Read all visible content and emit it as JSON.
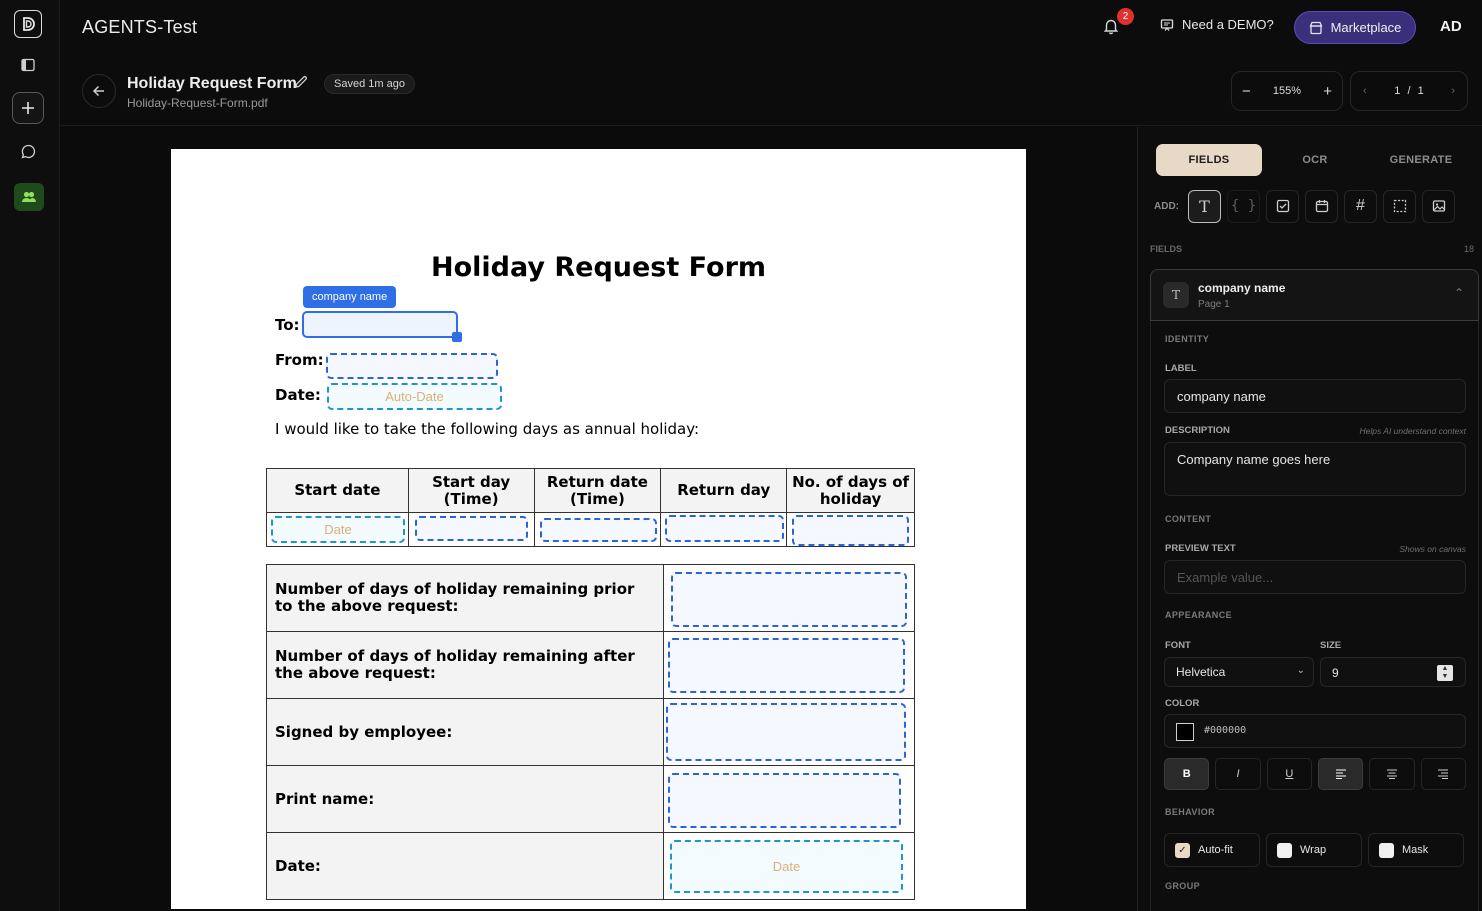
{
  "app": {
    "title": "AGENTS-Test",
    "notifications_count": "2",
    "demo_label": "Need a DEMO?",
    "marketplace_label": "Marketplace",
    "avatar_initials": "AD"
  },
  "doc": {
    "title": "Holiday Request Form",
    "saved_status": "Saved 1m ago",
    "filename": "Holiday-Request-Form.pdf",
    "zoom": "155%",
    "page_current": "1",
    "page_sep": "/",
    "page_total": "1"
  },
  "form": {
    "title": "Holiday Request Form",
    "selected_chip": "company name",
    "to_label": "To:",
    "from_label": "From:",
    "date_label": "Date:",
    "date_placeholder": "Auto-Date",
    "intro": "I would like to take the following days as annual holiday:",
    "table1_headers": [
      "Start date",
      "Start day (Time)",
      "Return date (Time)",
      "Return day",
      "No. of days of holiday"
    ],
    "table1_first_placeholder": "Date",
    "table2_rows": [
      "Number of days of holiday remaining prior to the above request:",
      "Number of days of holiday remaining after the above request:",
      "Signed by employee:",
      "Print name:",
      "Date:"
    ],
    "table2_date_placeholder": "Date"
  },
  "panel": {
    "tabs": [
      "FIELDS",
      "OCR",
      "GENERATE"
    ],
    "add_label": "ADD:",
    "tools": [
      "text-tool-icon",
      "variable-tool-icon",
      "checkbox-tool-icon",
      "calendar-tool-icon",
      "number-tool-icon",
      "region-tool-icon",
      "image-tool-icon"
    ],
    "fields_header": "FIELDS",
    "fields_count": "18",
    "field_card": {
      "name": "company name",
      "page": "Page 1"
    },
    "identity_section": "IDENTITY",
    "label_label": "LABEL",
    "label_value": "company name",
    "description_label": "DESCRIPTION",
    "description_hint": "Helps AI understand context",
    "description_value": "Company name goes here",
    "content_section": "CONTENT",
    "preview_label": "PREVIEW TEXT",
    "preview_hint": "Shows on canvas",
    "preview_placeholder": "Example value...",
    "appearance_section": "APPEARANCE",
    "font_label": "FONT",
    "font_value": "Helvetica",
    "size_label": "SIZE",
    "size_value": "9",
    "color_label": "COLOR",
    "color_value": "#000000",
    "format_buttons": [
      "B",
      "I",
      "U"
    ],
    "behavior_section": "BEHAVIOR",
    "behaviors": [
      {
        "label": "Auto-fit",
        "checked": true
      },
      {
        "label": "Wrap",
        "checked": false
      },
      {
        "label": "Mask",
        "checked": false
      }
    ],
    "group_section": "GROUP"
  },
  "colors": {
    "accent": "#2f6fe6",
    "marketplace": "#3a2f7a",
    "active_tab": "#e8d9c7",
    "badge": "#e03131"
  }
}
